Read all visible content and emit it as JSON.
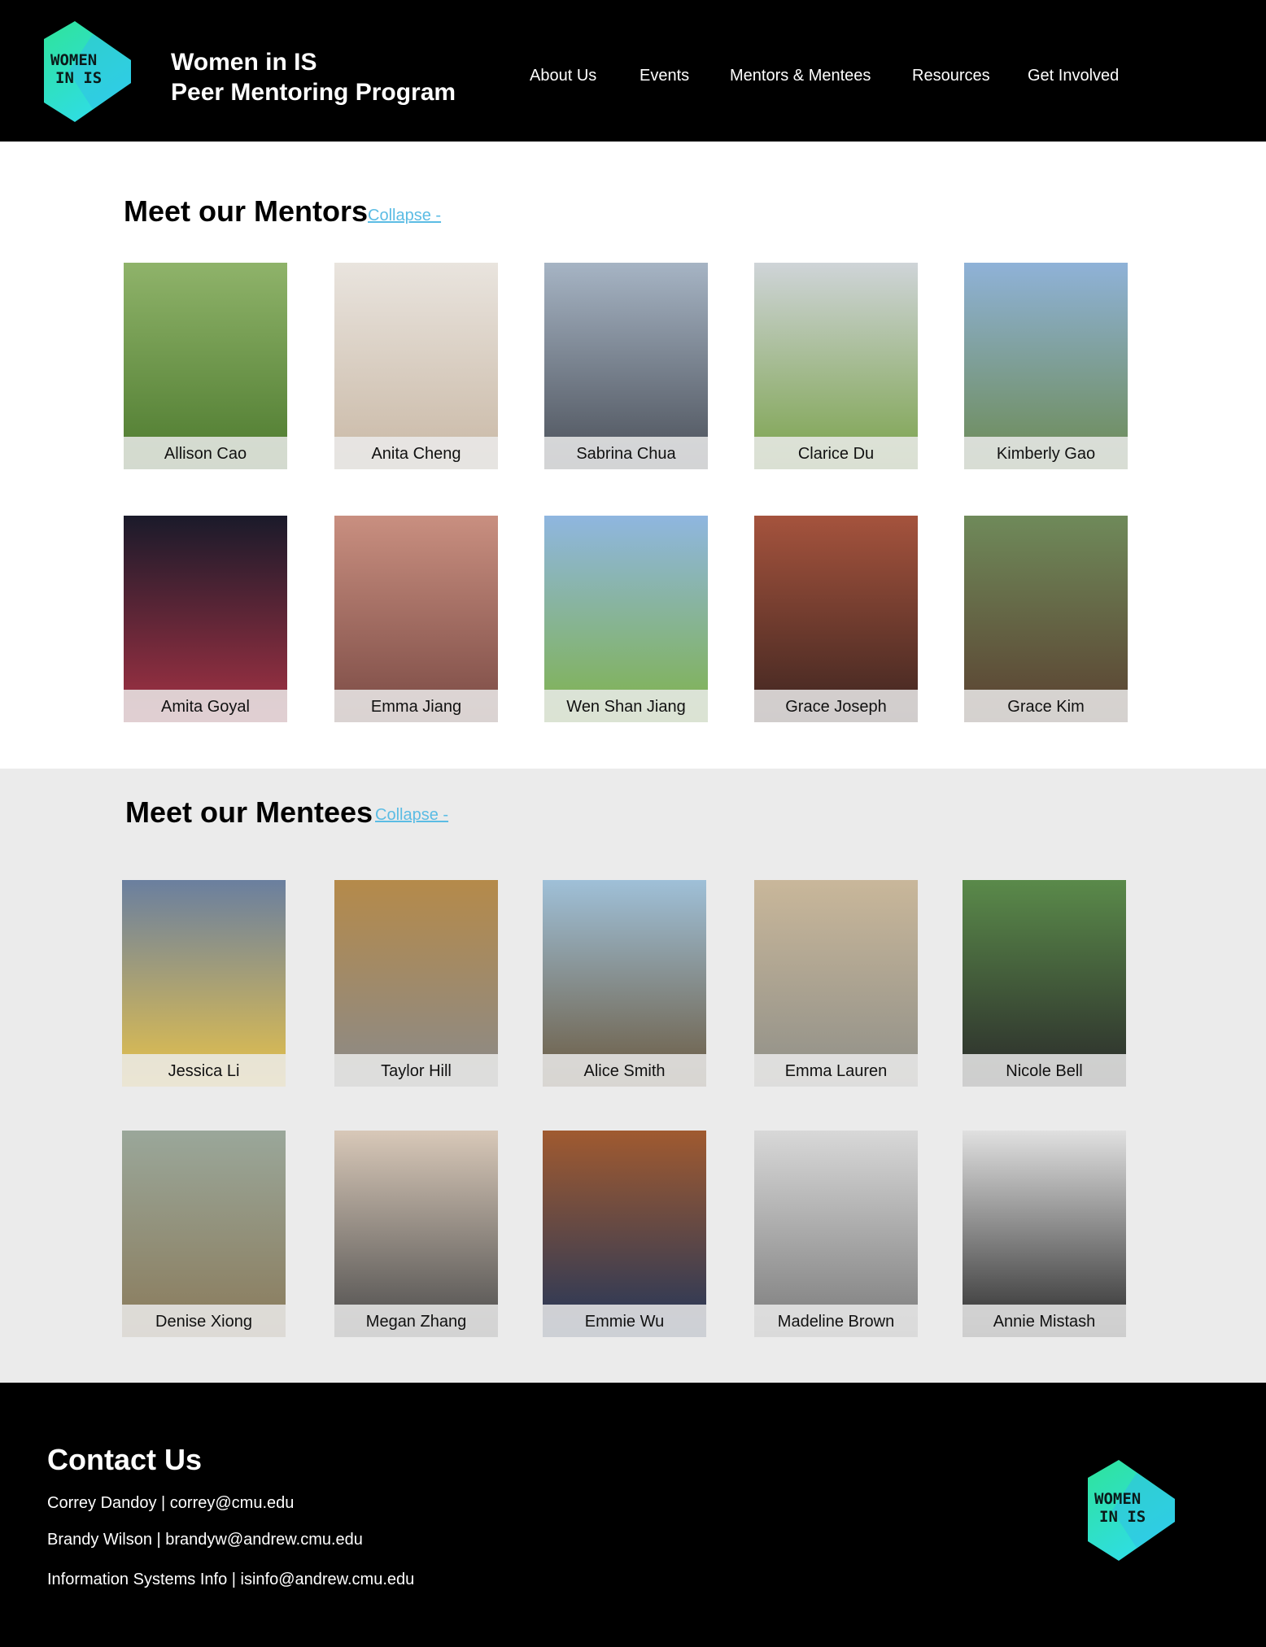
{
  "header": {
    "logo_text": "WOMEN IN IS",
    "title_line1": "Women in IS",
    "title_line2": "Peer Mentoring Program",
    "nav": [
      "About Us",
      "Events",
      "Mentors & Mentees",
      "Resources",
      "Get Involved"
    ]
  },
  "mentors": {
    "title": "Meet our Mentors",
    "collapse_label": "Collapse -",
    "people": [
      "Allison Cao",
      "Anita Cheng",
      "Sabrina Chua",
      "Clarice Du",
      "Kimberly Gao",
      "Amita Goyal",
      "Emma Jiang",
      "Wen Shan Jiang",
      "Grace Joseph",
      "Grace Kim"
    ]
  },
  "mentees": {
    "title": "Meet our Mentees",
    "collapse_label": "Collapse -",
    "people": [
      "Jessica Li",
      "Taylor Hill",
      "Alice Smith",
      "Emma Lauren",
      "Nicole Bell",
      "Denise Xiong",
      "Megan Zhang",
      "Emmie Wu",
      "Madeline Brown",
      "Annie Mistash"
    ]
  },
  "footer": {
    "title": "Contact Us",
    "lines": [
      "Correy Dandoy | correy@cmu.edu",
      "Brandy Wilson | brandyw@andrew.cmu.edu",
      "Information Systems Info | isinfo@andrew.cmu.edu"
    ],
    "logo_text": "WOMEN IN IS"
  },
  "colors": {
    "accent": "#5bbce4",
    "logo_green": "#2fe0a0",
    "logo_blue": "#30c3e8",
    "mentees_bg": "#ebebeb"
  }
}
